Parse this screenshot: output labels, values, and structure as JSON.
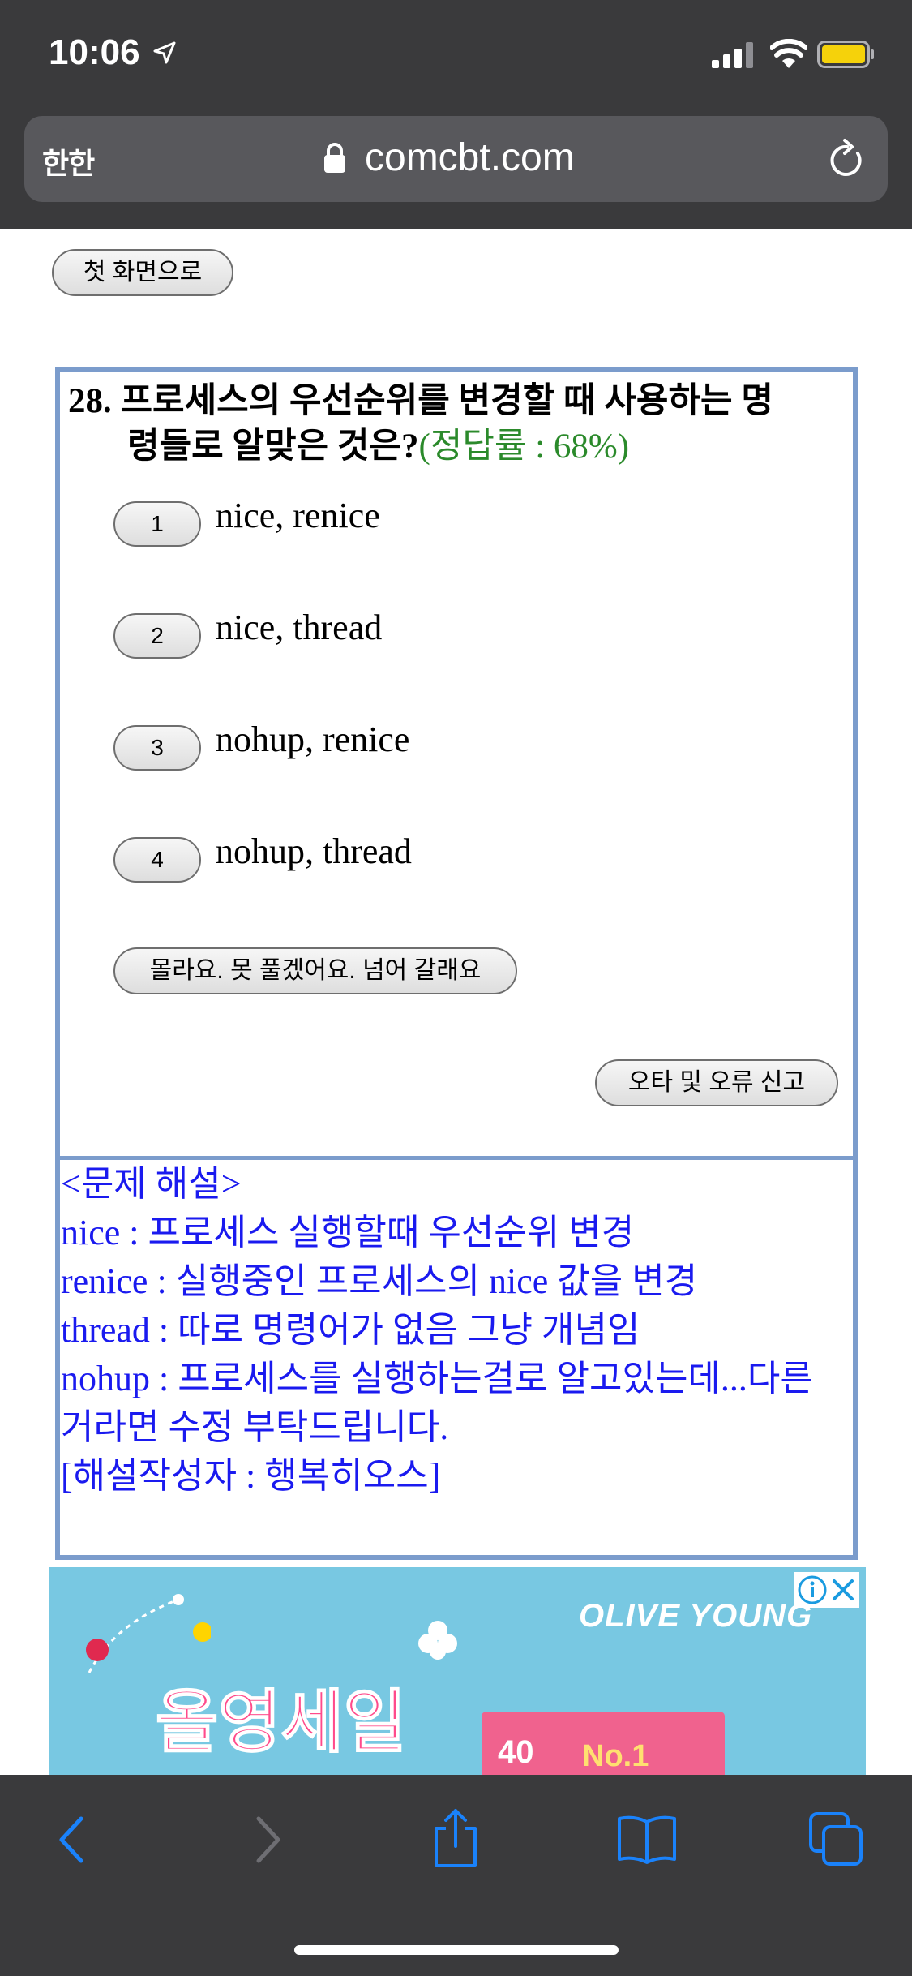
{
  "status_bar": {
    "time": "10:06"
  },
  "browser": {
    "aa_label": "한한",
    "url": "comcbt.com"
  },
  "page": {
    "home_button": "첫 화면으로",
    "question": {
      "number": "28.",
      "text_line1": "프로세스의 우선순위를 변경할 때 사용하는 명",
      "text_line2": "령들로 알맞은 것은?",
      "correct_rate": "(정답률 : 68%)"
    },
    "options": [
      {
        "num": "1",
        "text": "nice, renice"
      },
      {
        "num": "2",
        "text": "nice, thread"
      },
      {
        "num": "3",
        "text": "nohup, renice"
      },
      {
        "num": "4",
        "text": "nohup, thread"
      }
    ],
    "skip_button": "몰라요. 못 풀겠어요. 넘어 갈래요",
    "report_button": "오타 및 오류 신고",
    "explanation": {
      "heading": "<문제 해설>",
      "lines": [
        "nice : 프로세스 실행할때 우선순위 변경",
        "renice : 실행중인 프로세스의 nice 값을 변경",
        "thread : 따로 명령어가 없음 그냥 개념임",
        "nohup : 프로세스를 실행하는걸로 알고있는데...다른",
        "거라면 수정 부탁드립니다.",
        "[해설작성자 : 행복히오스]"
      ]
    }
  },
  "ad": {
    "brand": "OLIVE YOUNG",
    "banner_text": "올영세일",
    "box_text_1": "40",
    "box_text_2": "No.1"
  },
  "colors": {
    "chrome": "#3a3a3c",
    "box_border": "#7b9ccc",
    "explanation_text": "#1a1aef",
    "rate_text": "#2b8a2b",
    "browser_icon": "#1a82fb"
  }
}
